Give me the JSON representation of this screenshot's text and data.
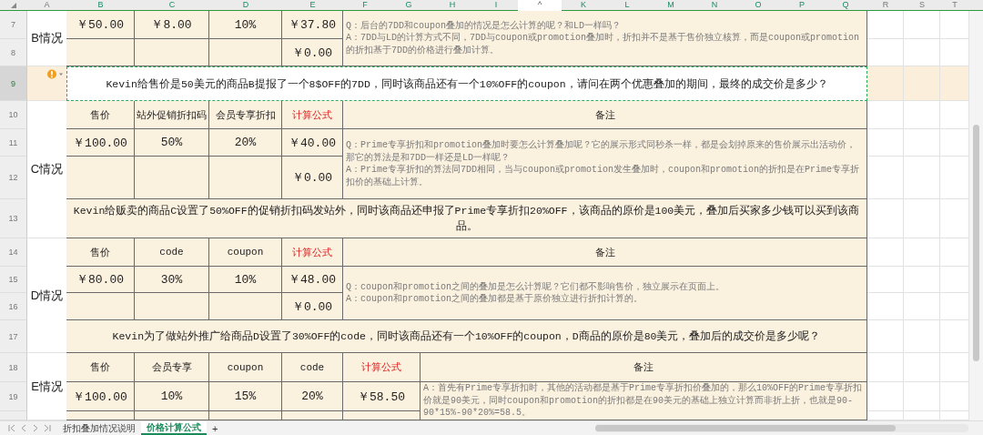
{
  "columns": [
    {
      "label": "A",
      "selected": false
    },
    {
      "label": "B",
      "selected": true
    },
    {
      "label": "C",
      "selected": true
    },
    {
      "label": "D",
      "selected": true
    },
    {
      "label": "E",
      "selected": true
    },
    {
      "label": "F",
      "selected": true
    },
    {
      "label": "G",
      "selected": true
    },
    {
      "label": "H",
      "selected": true
    },
    {
      "label": "I",
      "selected": true
    },
    {
      "label": "^",
      "selected": false,
      "kind": "hidden"
    },
    {
      "label": "K",
      "selected": true
    },
    {
      "label": "L",
      "selected": true
    },
    {
      "label": "M",
      "selected": true
    },
    {
      "label": "N",
      "selected": true
    },
    {
      "label": "O",
      "selected": true
    },
    {
      "label": "P",
      "selected": true
    },
    {
      "label": "Q",
      "selected": true
    },
    {
      "label": "R",
      "selected": false
    },
    {
      "label": "S",
      "selected": false
    },
    {
      "label": "T",
      "selected": false
    }
  ],
  "row_numbers": [
    {
      "label": "7",
      "selected": false
    },
    {
      "label": "8",
      "selected": false
    },
    {
      "label": "9",
      "selected": true
    },
    {
      "label": "10",
      "selected": false
    },
    {
      "label": "11",
      "selected": false
    },
    {
      "label": "12",
      "selected": false
    },
    {
      "label": "13",
      "selected": false
    },
    {
      "label": "14",
      "selected": false
    },
    {
      "label": "15",
      "selected": false
    },
    {
      "label": "16",
      "selected": false
    },
    {
      "label": "17",
      "selected": false
    },
    {
      "label": "18",
      "selected": false
    },
    {
      "label": "19",
      "selected": false
    }
  ],
  "sections": [
    {
      "label": "B情况",
      "values": [
        "￥50.00",
        "￥8.00",
        "10%",
        "￥37.80"
      ],
      "result": "￥0.00",
      "note": [
        "Q：后台的7DD和coupon叠加的情况是怎么计算的呢？和LD一样吗？",
        "A：7DD与LD的计算方式不同，7DD与coupon或promotion叠加时，折扣并不是基于售价独立核算，而是coupon或promotion的折扣基于7DD的价格进行叠加计算。"
      ],
      "question": {
        "text": "Kevin给售价是50美元的商品B提报了一个8$OFF的7DD，同时该商品还有一个10%OFF的coupon，请问在两个优惠叠加的期间，最终的成交价是多少？",
        "selected": true,
        "warning": true
      }
    },
    {
      "label": "C情况",
      "header": [
        {
          "text": "售价"
        },
        {
          "text": "站外促销折扣码"
        },
        {
          "text": "会员专享折扣"
        },
        {
          "text": "计算公式",
          "kind": "formula"
        },
        {
          "text": "备注",
          "kind": "note"
        }
      ],
      "values": [
        "￥100.00",
        "50%",
        "20%",
        "￥40.00"
      ],
      "result": "￥0.00",
      "note": [
        "Q：Prime专享折扣和promotion叠加时要怎么计算叠加呢？它的展示形式同秒杀一样，都是会划掉原来的售价展示出活动价，那它的算法是和7DD一样还是LD一样呢？",
        "A：Prime专享折扣的算法同7DD相同，当与coupon或promotion发生叠加时，coupon和promotion的折扣是在Prime专享折扣价的基础上计算。"
      ],
      "question": {
        "text": "Kevin给贩卖的商品C设置了50%OFF的促销折扣码发站外，同时该商品还申报了Prime专享折扣20%OFF，该商品的原价是100美元，叠加后买家多少钱可以买到该商品。",
        "selected": false,
        "warning": false
      }
    },
    {
      "label": "D情况",
      "header": [
        {
          "text": "售价"
        },
        {
          "text": "code"
        },
        {
          "text": "coupon"
        },
        {
          "text": "计算公式",
          "kind": "formula"
        },
        {
          "text": "备注",
          "kind": "note"
        }
      ],
      "values": [
        "￥80.00",
        "30%",
        "10%",
        "￥48.00"
      ],
      "result": "￥0.00",
      "note": [
        "Q：coupon和promotion之间的叠加是怎么计算呢？它们都不影响售价，独立展示在页面上。",
        "A：coupon和promotion之间的叠加都是基于原价独立进行折扣计算的。"
      ],
      "question": {
        "text": "Kevin为了做站外推广给商品D设置了30%OFF的code，同时该商品还有一个10%OFF的coupon，D商品的原价是80美元，叠加后的成交价是多少呢？",
        "selected": false,
        "warning": false
      }
    },
    {
      "label": "E情况",
      "header": [
        {
          "text": "售价"
        },
        {
          "text": "会员专享"
        },
        {
          "text": "coupon"
        },
        {
          "text": "code"
        },
        {
          "text": "计算公式",
          "kind": "formula"
        },
        {
          "text": "备注",
          "kind": "note"
        }
      ],
      "values": [
        "￥100.00",
        "10%",
        "15%",
        "20%",
        "￥58.50"
      ],
      "note": [
        "A：首先有Prime专享折扣时，其他的活动都是基于Prime专享折扣价叠加的，那么10%OFF的Prime专享折扣价就是90美元，同时coupon和promotion的折扣都是在90美元的基础上独立计算而非折上折，也就是90-90*15%-90*20%=58.5。"
      ]
    }
  ],
  "sheet_tabs": [
    {
      "label": "折扣叠加情况说明",
      "selected": false
    },
    {
      "label": "价格计算公式",
      "selected": true
    }
  ],
  "add_tab": "+"
}
